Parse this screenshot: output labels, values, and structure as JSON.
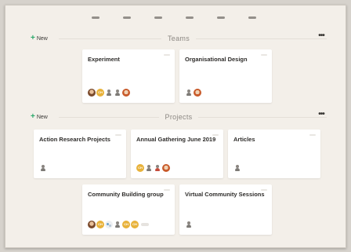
{
  "sections": [
    {
      "new_label": "New",
      "title": "Teams",
      "cards": [
        {
          "title": "Experiment",
          "avatars": [
            "photo1",
            "initials",
            "person",
            "person",
            "photo4"
          ]
        },
        {
          "title": "Organisational Design",
          "avatars": [
            "person",
            "photo4"
          ]
        }
      ]
    },
    {
      "new_label": "New",
      "title": "Projects",
      "cards": [
        {
          "title": "Action Research Projects",
          "avatars": [
            "person"
          ]
        },
        {
          "title": "Annual Gathering June 2019",
          "avatars": [
            "initials",
            "person",
            "person",
            "photo4"
          ]
        },
        {
          "title": "Articles",
          "avatars": [
            "person"
          ]
        },
        {
          "title": "Community Building group",
          "avatars": [
            "photo1",
            "initials",
            "dots",
            "person",
            "initials",
            "initials",
            "more"
          ]
        },
        {
          "title": "Virtual Community Sessions",
          "avatars": [
            "person"
          ]
        }
      ]
    }
  ],
  "colors": {
    "accent": "#2aa86a",
    "avatar_initials": "#e8b23a"
  }
}
